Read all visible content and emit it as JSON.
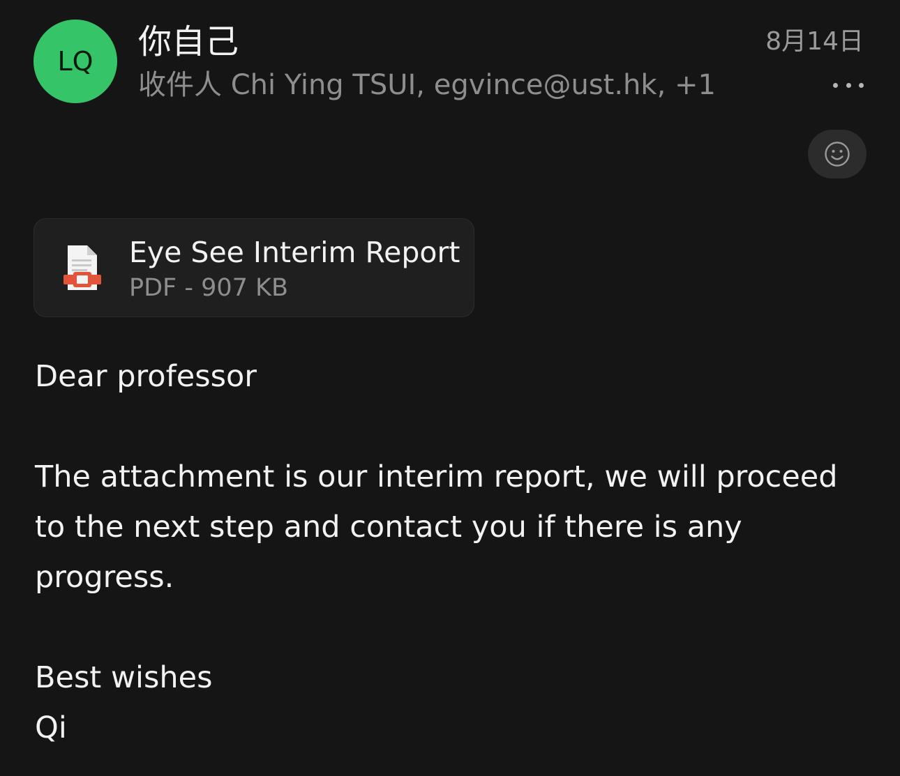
{
  "header": {
    "avatar_initials": "LQ",
    "avatar_color": "#35c568",
    "sender_name": "你自己",
    "date": "8月14日",
    "recipients": "收件人 Chi Ying TSUI, egvince@ust.hk, +1",
    "more_icon": "ellipsis-icon",
    "react_icon": "smiley-icon"
  },
  "attachment": {
    "name": "Eye See Interim Report",
    "meta": "PDF - 907 KB",
    "icon": "pdf-file-icon"
  },
  "body": {
    "greeting": "Dear professor",
    "line1": "The attachment is our interim report,  we will proceed",
    "line2": "to the next step and contact you if there is any",
    "line3": "progress.",
    "closing": "Best wishes",
    "signature": "Qi"
  }
}
